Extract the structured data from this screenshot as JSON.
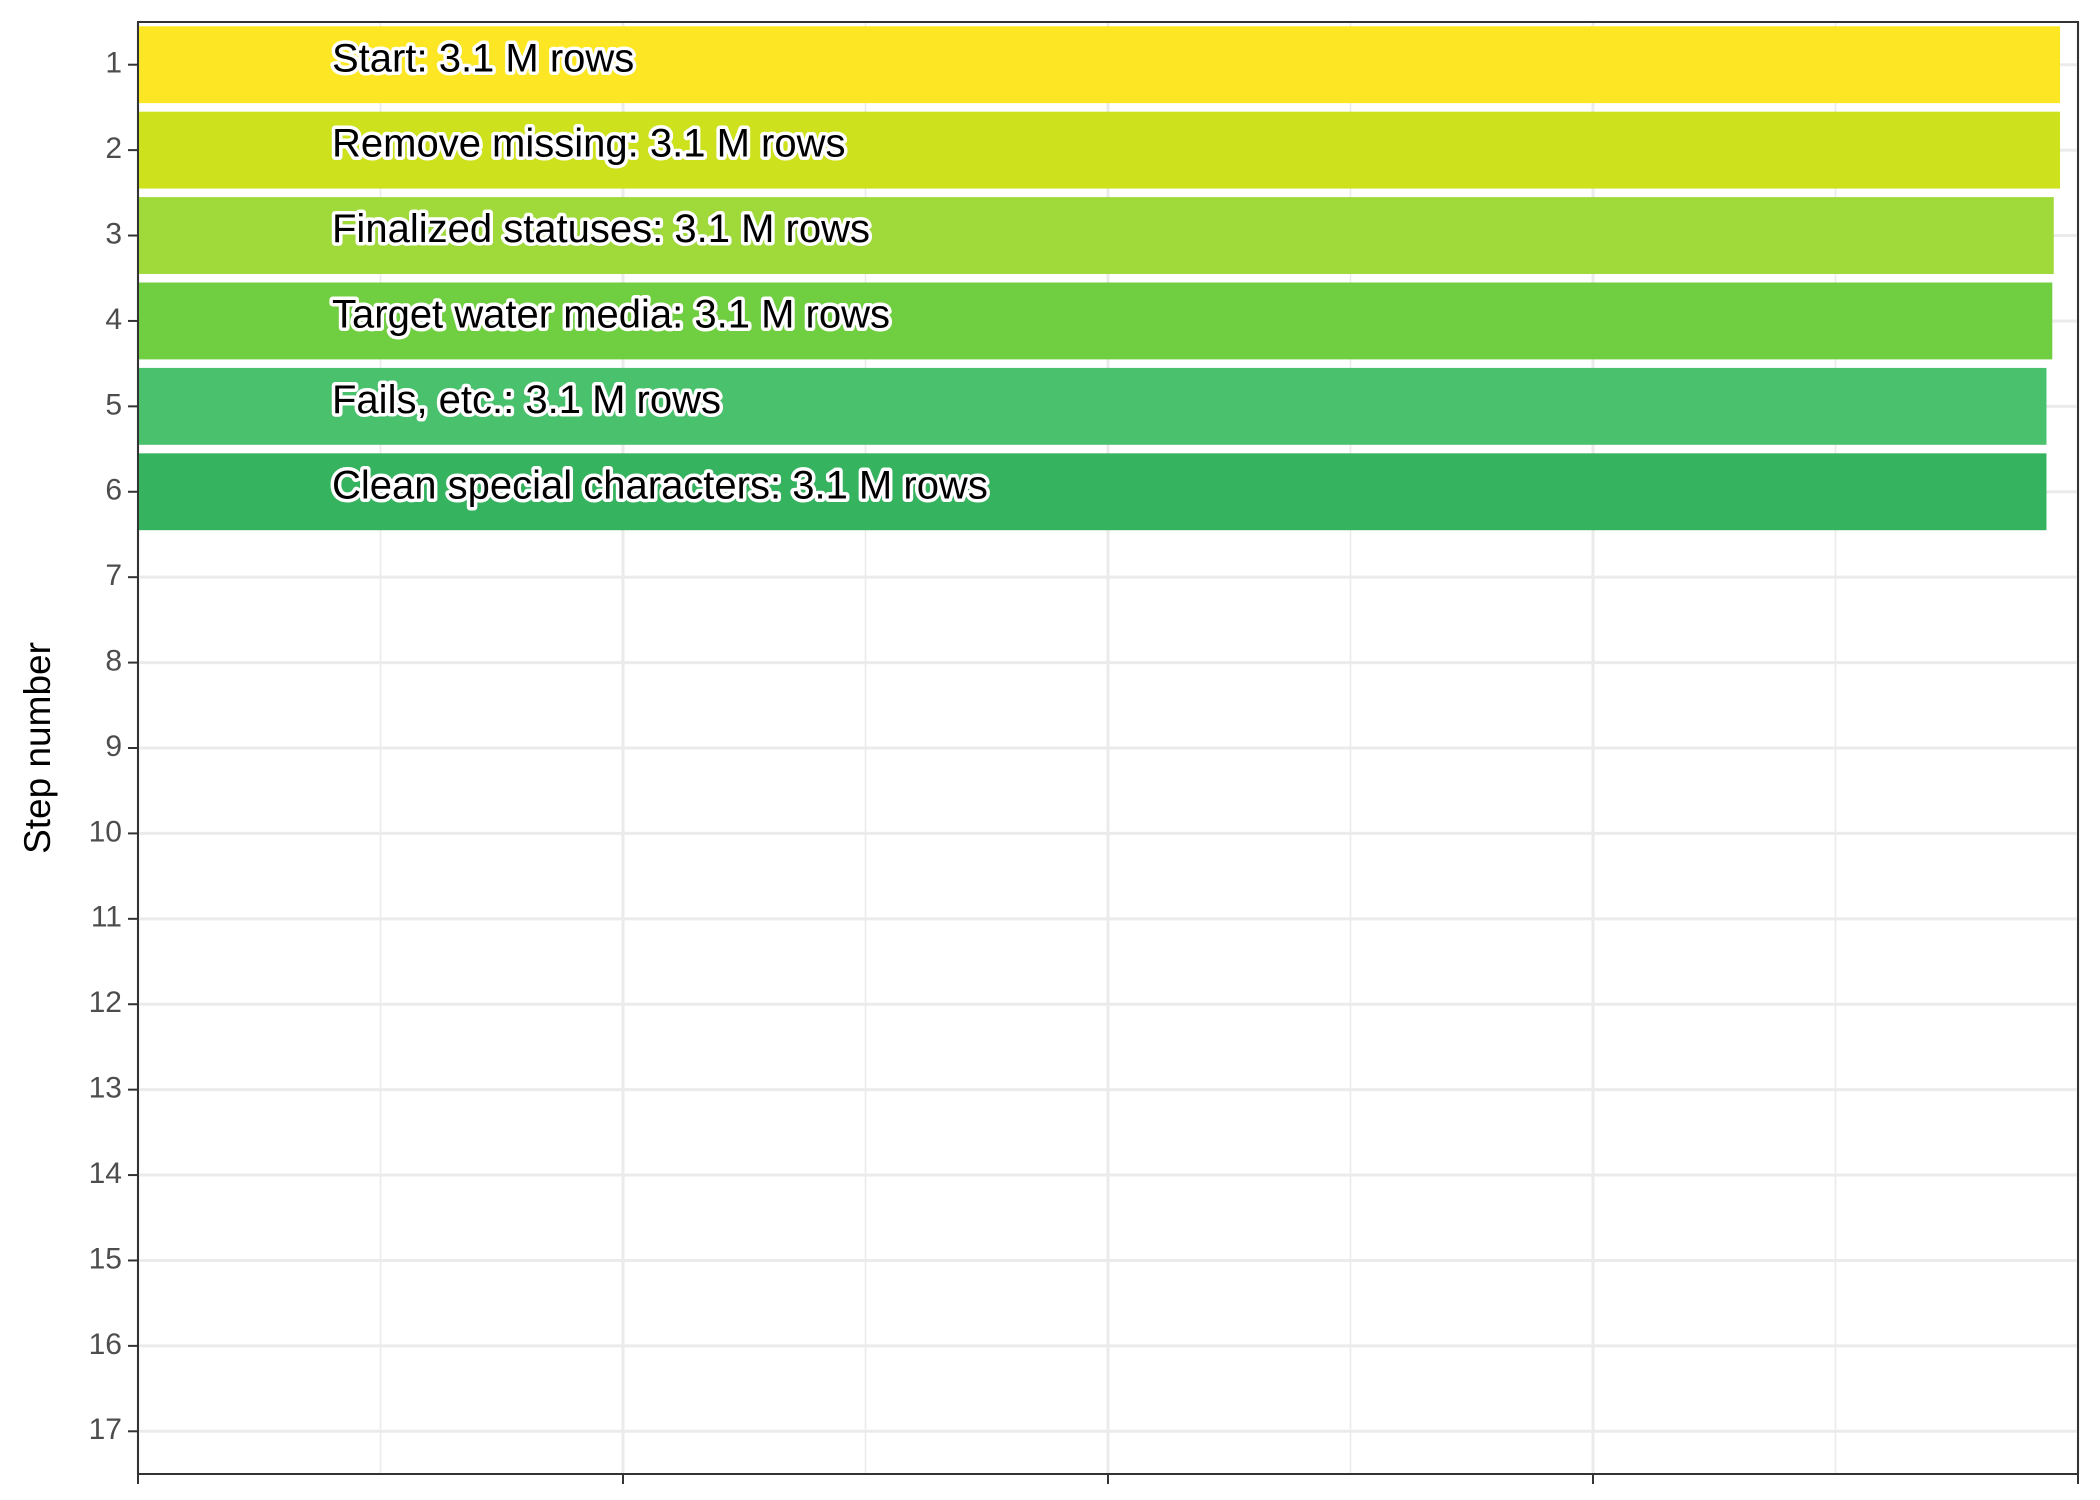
{
  "chart_data": {
    "type": "bar",
    "orientation": "horizontal",
    "title": "",
    "xlabel": "",
    "ylabel": "Step number",
    "y_ticks": [
      1,
      2,
      3,
      4,
      5,
      6,
      7,
      8,
      9,
      10,
      11,
      12,
      13,
      14,
      15,
      16,
      17
    ],
    "ylim": [
      0.5,
      17.5
    ],
    "xlim": [
      0,
      4.0
    ],
    "x_tick_values": [
      0,
      1,
      2,
      3,
      4
    ],
    "x_tick_labels": [
      "",
      "",
      "",
      "",
      ""
    ],
    "grid": true,
    "legend": "none",
    "bars": [
      {
        "step": 1,
        "label": "Start:  3.1 M rows",
        "value": 3.963,
        "color": "#FDE725"
      },
      {
        "step": 2,
        "label": "Remove missing:  3.1 M rows",
        "value": 3.963,
        "color": "#CDE11D"
      },
      {
        "step": 3,
        "label": "Finalized statuses:  3.1 M rows",
        "value": 3.95,
        "color": "#9FDA3A"
      },
      {
        "step": 4,
        "label": "Target water media:  3.1 M rows",
        "value": 3.947,
        "color": "#70CF40"
      },
      {
        "step": 5,
        "label": "Fails, etc.:  3.1 M rows",
        "value": 3.935,
        "color": "#4AC16D"
      },
      {
        "step": 6,
        "label": "Clean special characters:  3.1 M rows",
        "value": 3.935,
        "color": "#35B35F"
      }
    ]
  }
}
